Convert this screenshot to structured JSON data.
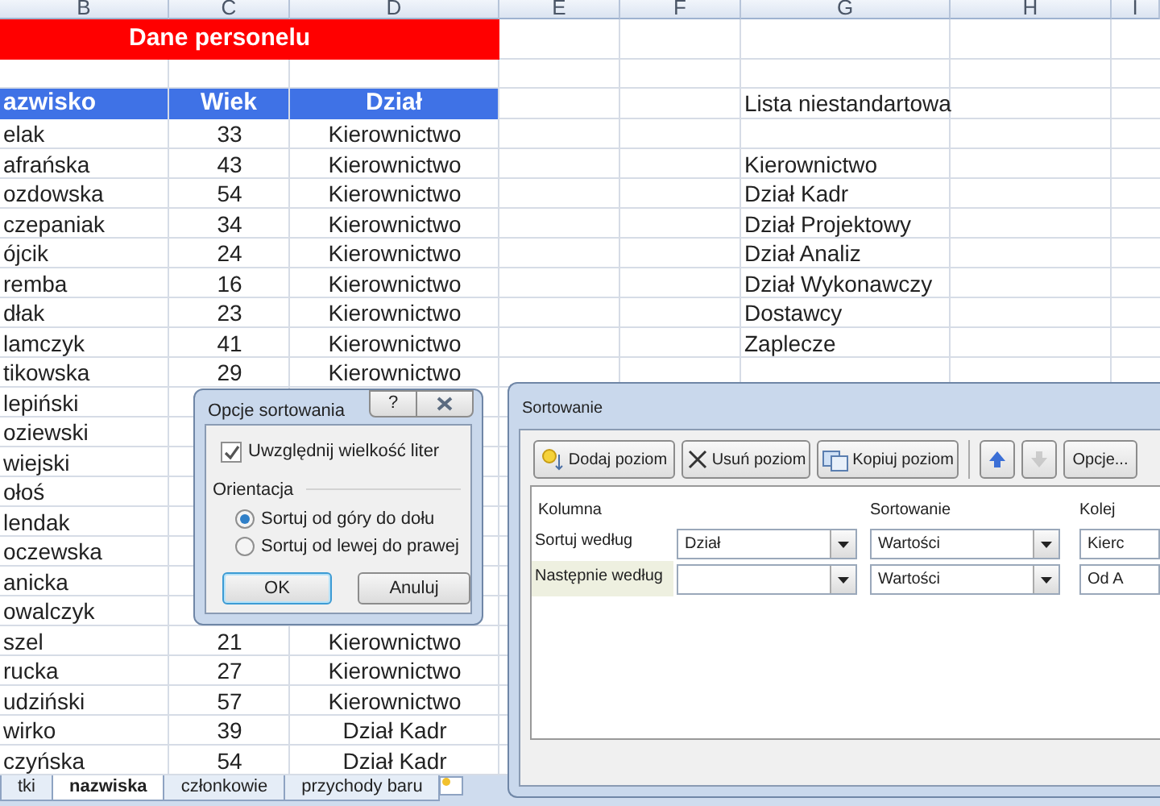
{
  "column_headers": [
    "B",
    "C",
    "D",
    "E",
    "F",
    "G",
    "H",
    "I"
  ],
  "title_cell": "Dane personelu",
  "table_header": [
    "azwisko",
    "Wiek",
    "Dział"
  ],
  "custom_list": {
    "title": "Lista niestandartowa",
    "items": [
      "Kierownictwo",
      "Dział Kadr",
      "Dział Projektowy",
      "Dział Analiz",
      "Dział Wykonawczy",
      "Dostawcy",
      "Zaplecze"
    ]
  },
  "rows": [
    {
      "name": "elak",
      "age": "33",
      "dept": "Kierownictwo"
    },
    {
      "name": "afrańska",
      "age": "43",
      "dept": "Kierownictwo"
    },
    {
      "name": "ozdowska",
      "age": "54",
      "dept": "Kierownictwo"
    },
    {
      "name": "czepaniak",
      "age": "34",
      "dept": "Kierownictwo"
    },
    {
      "name": "ójcik",
      "age": "24",
      "dept": "Kierownictwo"
    },
    {
      "name": "remba",
      "age": "16",
      "dept": "Kierownictwo"
    },
    {
      "name": "dłak",
      "age": "23",
      "dept": "Kierownictwo"
    },
    {
      "name": "lamczyk",
      "age": "41",
      "dept": "Kierownictwo"
    },
    {
      "name": "tikowska",
      "age": "29",
      "dept": "Kierownictwo"
    },
    {
      "name": "lepiński"
    },
    {
      "name": "oziewski"
    },
    {
      "name": "wiejski"
    },
    {
      "name": "ołoś"
    },
    {
      "name": "lendak"
    },
    {
      "name": "oczewska"
    },
    {
      "name": "anicka"
    },
    {
      "name": "owalczyk"
    },
    {
      "name": "szel",
      "age": "21",
      "dept": "Kierownictwo"
    },
    {
      "name": "rucka",
      "age": "27",
      "dept": "Kierownictwo"
    },
    {
      "name": "udziński",
      "age": "57",
      "dept": "Kierownictwo"
    },
    {
      "name": "wirko",
      "age": "39",
      "dept": "Dział Kadr"
    },
    {
      "name": "czyńska",
      "age": "54",
      "dept": "Dział Kadr"
    }
  ],
  "sheet_tabs": [
    {
      "label": "tki",
      "selected": false
    },
    {
      "label": "nazwiska",
      "selected": true
    },
    {
      "label": "członkowie",
      "selected": false
    },
    {
      "label": "przychody baru",
      "selected": false
    }
  ],
  "options_dialog": {
    "title": "Opcje sortowania",
    "help": "?",
    "case_sensitive": {
      "label": "Uwzględnij wielkość liter",
      "checked": true
    },
    "group": "Orientacja",
    "orientation": [
      {
        "label": "Sortuj od góry do dołu",
        "selected": true
      },
      {
        "label": "Sortuj od lewej do prawej",
        "selected": false
      }
    ],
    "buttons": [
      {
        "label": "OK",
        "focused": true
      },
      {
        "label": "Anuluj",
        "focused": false
      }
    ]
  },
  "sort_dialog": {
    "title": "Sortowanie",
    "toolbar": [
      {
        "kind": "add",
        "label": "Dodaj poziom",
        "disabled": false
      },
      {
        "kind": "delete",
        "label": "Usuń poziom",
        "disabled": false
      },
      {
        "kind": "copy",
        "label": "Kopiuj poziom",
        "disabled": false
      },
      {
        "kind": "up",
        "disabled": false
      },
      {
        "kind": "down",
        "disabled": true
      },
      {
        "kind": "options",
        "label": "Opcje...",
        "disabled": false
      }
    ],
    "columns": [
      "Kolumna",
      "Sortowanie",
      "Kolej"
    ],
    "levels": [
      {
        "label": "Sortuj według",
        "column": "Dział",
        "sort_on": "Wartości",
        "order": "Kierc",
        "selected": false
      },
      {
        "label": "Następnie według",
        "sort_on": "Wartości",
        "order": "Od A",
        "selected": true
      }
    ]
  }
}
